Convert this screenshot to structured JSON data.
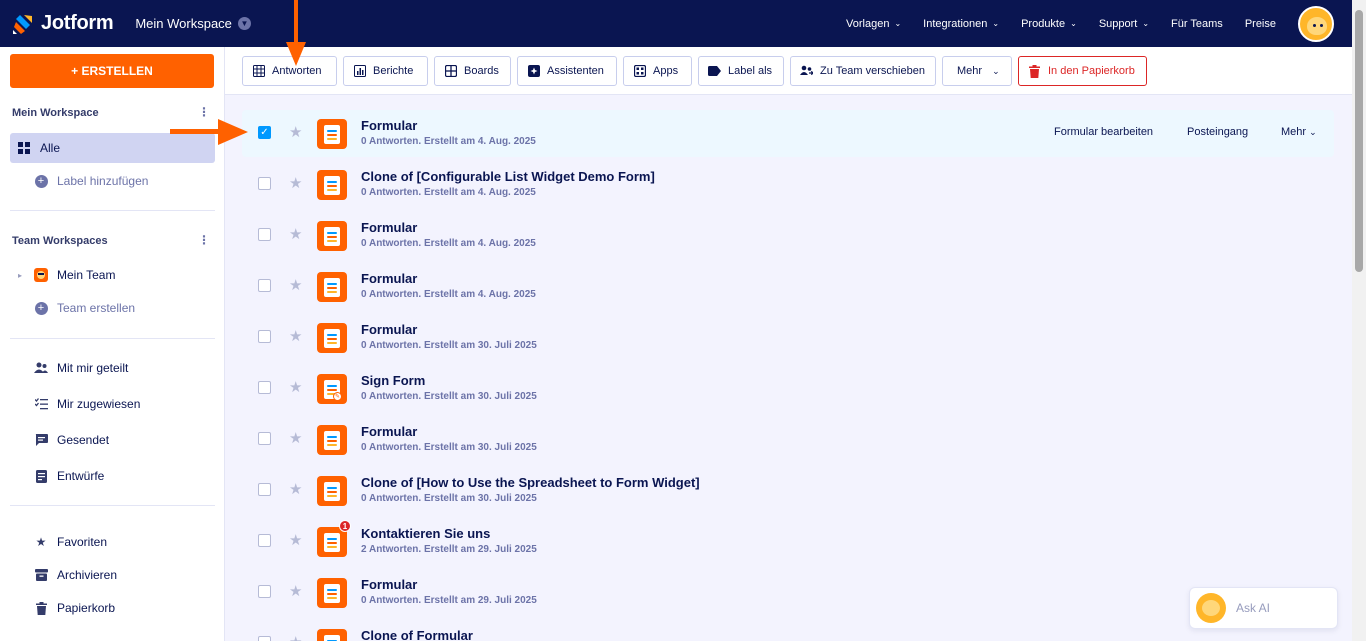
{
  "header": {
    "logo_text": "Jotform",
    "workspace_title": "Mein Workspace",
    "nav": [
      {
        "label": "Vorlagen",
        "dropdown": true
      },
      {
        "label": "Integrationen",
        "dropdown": true
      },
      {
        "label": "Produkte",
        "dropdown": true
      },
      {
        "label": "Support",
        "dropdown": true
      },
      {
        "label": "Für Teams",
        "dropdown": false
      },
      {
        "label": "Preise",
        "dropdown": false
      }
    ]
  },
  "sidebar": {
    "create_label": "+ ERSTELLEN",
    "my_workspace_title": "Mein Workspace",
    "all_label": "Alle",
    "add_label": "Label hinzufügen",
    "team_workspaces_title": "Team Workspaces",
    "my_team_label": "Mein Team",
    "create_team_label": "Team erstellen",
    "shared_label": "Mit mir geteilt",
    "assigned_label": "Mir zugewiesen",
    "sent_label": "Gesendet",
    "drafts_label": "Entwürfe",
    "favorites_label": "Favoriten",
    "archive_label": "Archivieren",
    "trash_label": "Papierkorb"
  },
  "toolbar": {
    "responses": "Antworten",
    "reports": "Berichte",
    "boards": "Boards",
    "assistants": "Assistenten",
    "apps": "Apps",
    "label_as": "Label als",
    "move_team": "Zu Team verschieben",
    "more": "Mehr",
    "trash": "In den Papierkorb"
  },
  "row_actions": {
    "edit": "Formular bearbeiten",
    "inbox": "Posteingang",
    "more": "Mehr"
  },
  "forms": [
    {
      "title": "Formular",
      "meta": "0 Antworten. Erstellt am 4. Aug. 2025",
      "checked": true
    },
    {
      "title": "Clone of [Configurable List Widget Demo Form]",
      "meta": "0 Antworten. Erstellt am 4. Aug. 2025",
      "checked": false
    },
    {
      "title": "Formular",
      "meta": "0 Antworten. Erstellt am 4. Aug. 2025",
      "checked": false
    },
    {
      "title": "Formular",
      "meta": "0 Antworten. Erstellt am 4. Aug. 2025",
      "checked": false
    },
    {
      "title": "Formular",
      "meta": "0 Antworten. Erstellt am 30. Juli 2025",
      "checked": false
    },
    {
      "title": "Sign Form",
      "meta": "0 Antworten. Erstellt am 30. Juli 2025",
      "checked": false
    },
    {
      "title": "Formular",
      "meta": "0 Antworten. Erstellt am 30. Juli 2025",
      "checked": false
    },
    {
      "title": "Clone of [How to Use the Spreadsheet to Form Widget]",
      "meta": "0 Antworten. Erstellt am 30. Juli 2025",
      "checked": false
    },
    {
      "title": "Kontaktieren Sie uns",
      "meta": "2 Antworten. Erstellt am 29. Juli 2025",
      "checked": false,
      "badge": "1"
    },
    {
      "title": "Formular",
      "meta": "0 Antworten. Erstellt am 29. Juli 2025",
      "checked": false
    },
    {
      "title": "Clone of Formular",
      "meta": "",
      "checked": false
    }
  ],
  "ask_ai_label": "Ask AI",
  "colors": {
    "navy": "#0a1551",
    "orange": "#ff6100",
    "selected_row": "#edf8ff",
    "danger": "#dc2626"
  }
}
